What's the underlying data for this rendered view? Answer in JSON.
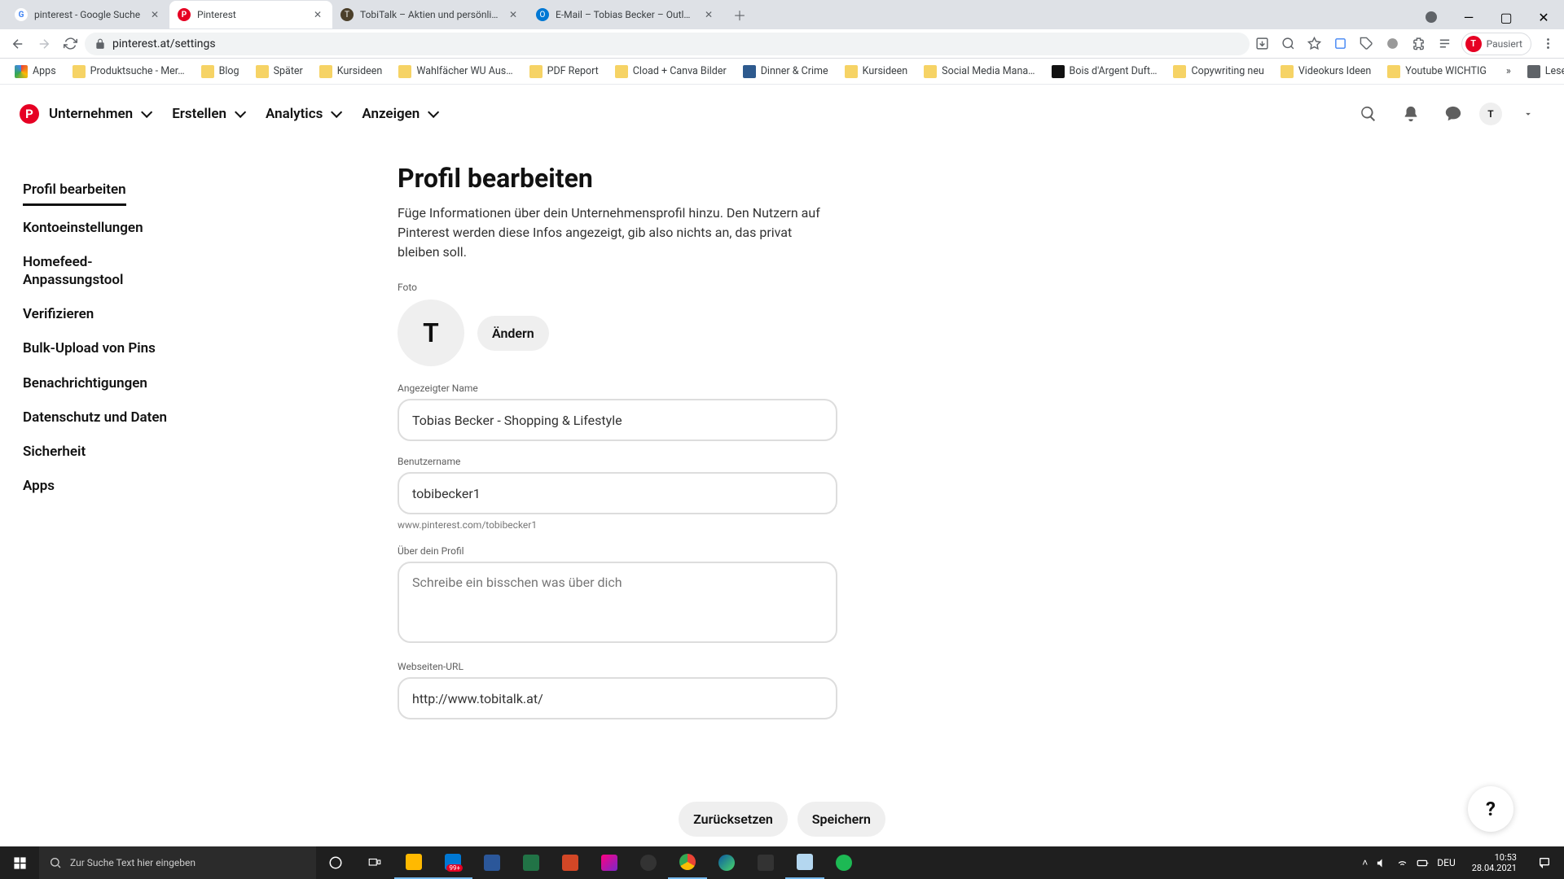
{
  "browser": {
    "tabs": [
      {
        "title": "pinterest - Google Suche",
        "favicon": "G"
      },
      {
        "title": "Pinterest",
        "favicon": "P",
        "active": true
      },
      {
        "title": "TobiTalk – Aktien und persönlich…",
        "favicon": "T"
      },
      {
        "title": "E-Mail – Tobias Becker – Outlook",
        "favicon": "O"
      }
    ],
    "url": "pinterest.at/settings",
    "profile_status": "Pausiert",
    "profile_initial": "T"
  },
  "bookmarks": {
    "apps": "Apps",
    "items": [
      "Produktsuche - Mer…",
      "Blog",
      "Später",
      "Kursideen",
      "Wahlfächer WU Aus…",
      "PDF Report",
      "Cload + Canva Bilder",
      "Dinner & Crime",
      "Kursideen",
      "Social Media Mana…",
      "Bois d'Argent Duft…",
      "Copywriting neu",
      "Videokurs Ideen",
      "Youtube WICHTIG"
    ],
    "readlist": "Leseliste"
  },
  "header": {
    "nav": [
      "Unternehmen",
      "Erstellen",
      "Analytics",
      "Anzeigen"
    ],
    "avatar_initial": "T"
  },
  "sidebar": {
    "items": [
      "Profil bearbeiten",
      "Kontoeinstellungen",
      "Homefeed-Anpassungstool",
      "Verifizieren",
      "Bulk-Upload von Pins",
      "Benachrichtigungen",
      "Datenschutz und Daten",
      "Sicherheit",
      "Apps"
    ]
  },
  "main": {
    "title": "Profil bearbeiten",
    "description": "Füge Informationen über dein Unternehmensprofil hinzu. Den Nutzern auf Pinterest werden diese Infos angezeigt, gib also nichts an, das privat bleiben soll.",
    "photo_label": "Foto",
    "avatar_letter": "T",
    "change_btn": "Ändern",
    "display_name_label": "Angezeigter Name",
    "display_name_value": "Tobias Becker - Shopping & Lifestyle",
    "username_label": "Benutzername",
    "username_value": "tobibecker1",
    "username_helper": "www.pinterest.com/tobibecker1",
    "about_label": "Über dein Profil",
    "about_placeholder": "Schreibe ein bisschen was über dich",
    "website_label": "Webseiten-URL",
    "website_value": "http://www.tobitalk.at/"
  },
  "footer": {
    "reset": "Zurücksetzen",
    "save": "Speichern"
  },
  "taskbar": {
    "search_placeholder": "Zur Suche Text hier eingeben",
    "lang": "DEU",
    "time": "10:53",
    "date": "28.04.2021"
  }
}
